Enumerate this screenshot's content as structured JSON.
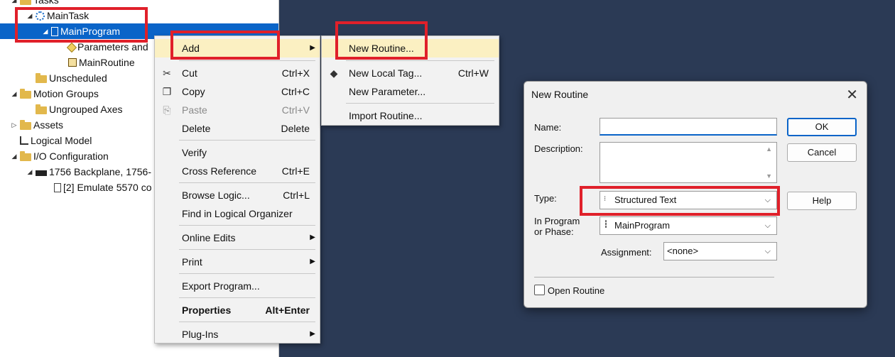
{
  "tree": {
    "items": [
      {
        "label": "Tasks"
      },
      {
        "label": "MainTask"
      },
      {
        "label": "MainProgram"
      },
      {
        "label": "Parameters and"
      },
      {
        "label": "MainRoutine"
      },
      {
        "label": "Unscheduled"
      },
      {
        "label": "Motion Groups"
      },
      {
        "label": "Ungrouped Axes"
      },
      {
        "label": "Assets"
      },
      {
        "label": "Logical Model"
      },
      {
        "label": "I/O Configuration"
      },
      {
        "label": "1756 Backplane, 1756-"
      },
      {
        "label": "[2] Emulate 5570 co"
      }
    ]
  },
  "context_menu": {
    "items": [
      {
        "label": "Add"
      },
      {
        "label": "Cut",
        "shortcut": "Ctrl+X"
      },
      {
        "label": "Copy",
        "shortcut": "Ctrl+C"
      },
      {
        "label": "Paste",
        "shortcut": "Ctrl+V"
      },
      {
        "label": "Delete",
        "shortcut": "Delete"
      },
      {
        "label": "Verify"
      },
      {
        "label": "Cross Reference",
        "shortcut": "Ctrl+E"
      },
      {
        "label": "Browse Logic...",
        "shortcut": "Ctrl+L"
      },
      {
        "label": "Find in Logical Organizer"
      },
      {
        "label": "Online Edits"
      },
      {
        "label": "Print"
      },
      {
        "label": "Export Program..."
      },
      {
        "label": "Properties",
        "shortcut": "Alt+Enter"
      },
      {
        "label": "Plug-Ins"
      }
    ]
  },
  "submenu": {
    "items": [
      {
        "label": "New Routine..."
      },
      {
        "label": "New Local Tag...",
        "shortcut": "Ctrl+W"
      },
      {
        "label": "New Parameter..."
      },
      {
        "label": "Import Routine..."
      }
    ]
  },
  "dialog": {
    "title": "New Routine",
    "name_label": "Name:",
    "name_value": "",
    "description_label": "Description:",
    "type_label": "Type:",
    "type_value": "Structured Text",
    "in_program_label_1": "In Program",
    "in_program_label_2": "or Phase:",
    "in_program_value": "MainProgram",
    "assignment_label": "Assignment:",
    "assignment_value": "<none>",
    "open_routine_label": "Open Routine",
    "open_routine_checked": false,
    "ok_label": "OK",
    "cancel_label": "Cancel",
    "help_label": "Help"
  },
  "colors": {
    "background": "#2b3a55",
    "selection": "#0a64c8",
    "highlight_box": "#e0202a",
    "menu_hover": "#fbf0c2"
  }
}
